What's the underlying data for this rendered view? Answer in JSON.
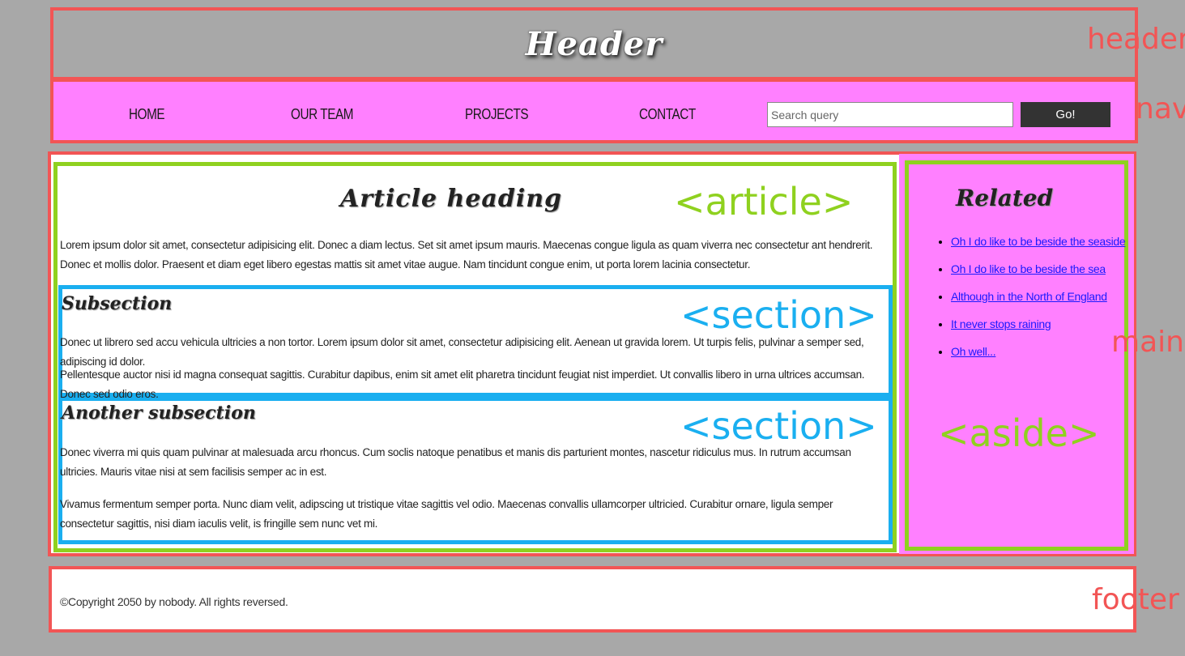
{
  "header": {
    "title": "Header"
  },
  "nav": {
    "links": [
      "HOME",
      "OUR TEAM",
      "PROJECTS",
      "CONTACT"
    ],
    "search_placeholder": "Search query",
    "go_label": "Go!"
  },
  "article": {
    "heading": "Article heading",
    "intro": "Lorem ipsum dolor sit amet, consectetur adipisicing elit. Donec a diam lectus. Set sit amet ipsum mauris. Maecenas congue ligula as quam viverra nec consectetur ant hendrerit. Donec et mollis dolor. Praesent et diam eget libero egestas mattis sit amet vitae augue. Nam tincidunt congue enim, ut porta lorem lacinia consectetur.",
    "sections": [
      {
        "heading": "Subsection",
        "paragraphs": [
          "Donec ut librero sed accu vehicula ultricies a non tortor. Lorem ipsum dolor sit amet, consectetur adipisicing elit. Aenean ut gravida lorem. Ut turpis felis, pulvinar a semper sed, adipiscing id dolor.",
          "Pellentesque auctor nisi id magna consequat sagittis. Curabitur dapibus, enim sit amet elit pharetra tincidunt feugiat nist imperdiet. Ut convallis libero in urna ultrices accumsan. Donec sed odio eros."
        ]
      },
      {
        "heading": "Another subsection",
        "paragraphs": [
          "Donec viverra mi quis quam pulvinar at malesuada arcu rhoncus. Cum soclis natoque penatibus et manis dis parturient montes, nascetur ridiculus mus. In rutrum accumsan ultricies. Mauris vitae nisi at sem facilisis semper ac in est.",
          "Vivamus fermentum semper porta. Nunc diam velit, adipscing ut tristique vitae sagittis vel odio. Maecenas convallis ullamcorper ultricied. Curabitur ornare, ligula semper consectetur sagittis, nisi diam iaculis velit, is fringille sem nunc vet mi."
        ]
      }
    ]
  },
  "aside": {
    "heading": "Related",
    "links": [
      "Oh I do like to be beside the seaside",
      "Oh I do like to be beside the sea",
      "Although in the North of England",
      "It never stops raining",
      "Oh well..."
    ]
  },
  "footer": {
    "text": "©Copyright 2050 by nobody. All rights reversed."
  },
  "annotations": {
    "header": "header",
    "nav": "nav",
    "main": "main",
    "footer": "footer",
    "article": "<article>",
    "section": "<section>",
    "aside": "<aside>"
  },
  "colors": {
    "page_bg": "#a8a8a8",
    "region_outline": "#f25555",
    "nav_bg": "#ff80ff",
    "article_outline": "#8fd11f",
    "section_outline": "#1aaff0"
  }
}
